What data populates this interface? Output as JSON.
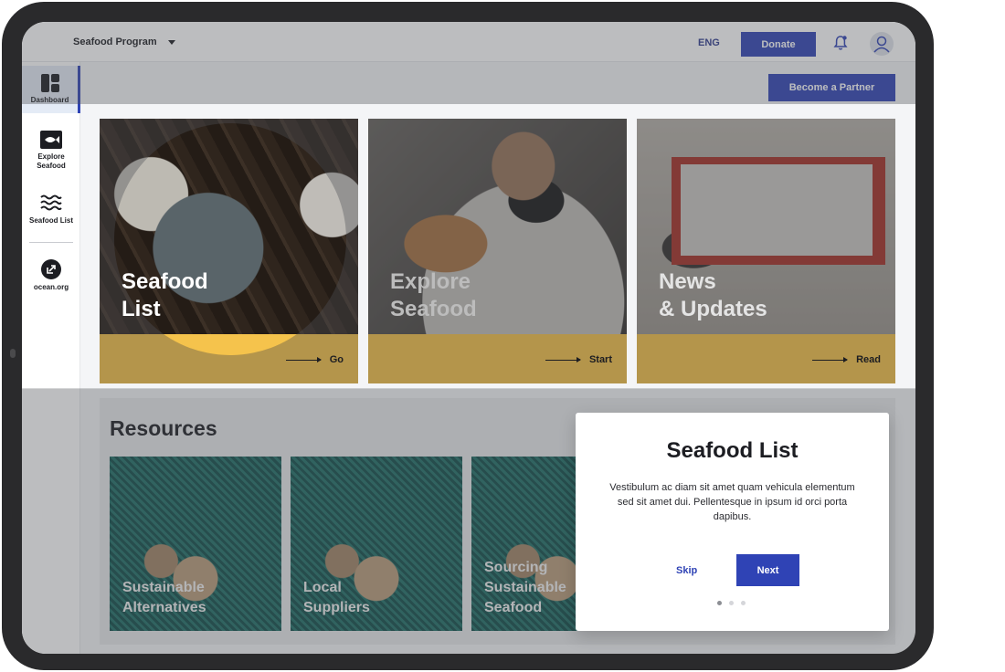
{
  "header": {
    "program": "Seafood Program",
    "language": "ENG",
    "donate_label": "Donate",
    "bell_icon": "bell-icon",
    "user_icon": "user-icon"
  },
  "sidebar": {
    "items": [
      {
        "label": "Dashboard",
        "icon": "dashboard-icon",
        "active": true
      },
      {
        "label": "Explore Seafood",
        "icon": "fish-icon"
      },
      {
        "label": "Seafood List",
        "icon": "waves-icon"
      },
      {
        "label": "ocean.org",
        "icon": "external-link-icon"
      }
    ]
  },
  "partner_label": "Become a Partner",
  "cards": [
    {
      "title": "Seafood\nList",
      "action": "Go"
    },
    {
      "title": "Explore\nSeafood",
      "action": "Start"
    },
    {
      "title": "News\n& Updates",
      "action": "Read"
    }
  ],
  "resources": {
    "title": "Resources",
    "items": [
      "Sustainable\nAlternatives",
      "Local\nSuppliers",
      "Sourcing\nSustainable\nSeafood"
    ]
  },
  "dialog": {
    "title": "Seafood List",
    "body": "Vestibulum ac diam sit amet quam vehicula elementum sed sit amet dui. Pellentesque in ipsum id orci porta dapibus.",
    "skip_label": "Skip",
    "next_label": "Next",
    "step": 1,
    "steps": 3
  },
  "colors": {
    "primary": "#2f43b5",
    "accent": "#f2bf45",
    "resource_bg": "#13524f"
  }
}
